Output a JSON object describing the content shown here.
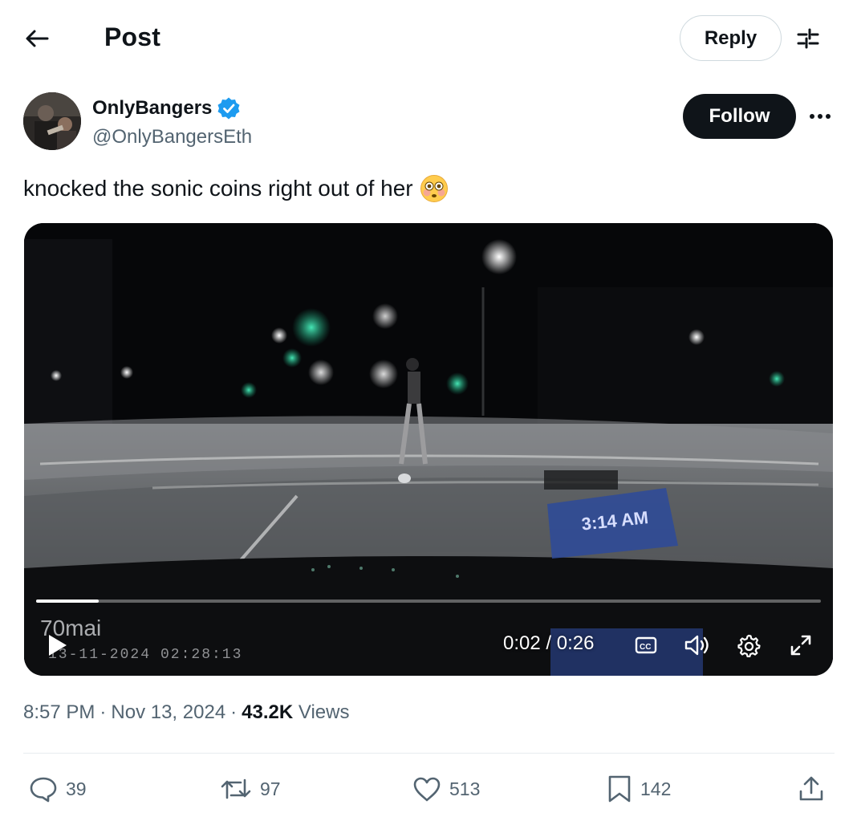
{
  "header": {
    "title": "Post",
    "reply_label": "Reply",
    "back_icon": "arrow-left-icon",
    "filter_icon": "sliders-icon"
  },
  "author": {
    "name": "OnlyBangers",
    "handle": "@OnlyBangersEth",
    "verified": true,
    "follow_label": "Follow"
  },
  "tweet": {
    "text": "knocked the sonic coins right out of her",
    "emoji": "flushed-face"
  },
  "video": {
    "time_current": "0:02",
    "time_separator": "/",
    "time_total": "0:26",
    "progress_fraction": 0.08,
    "controls": [
      "play-icon",
      "captions-icon",
      "volume-icon",
      "settings-icon",
      "fullscreen-icon"
    ],
    "overlay": {
      "brand": "70mai",
      "date_stamp": "13-11-2024",
      "time_stamp": "02:28:13",
      "sign_text": "3:14 AM"
    }
  },
  "meta": {
    "time": "8:57 PM",
    "separator": "·",
    "date": "Nov 13, 2024",
    "views_count": "43.2K",
    "views_label": "Views"
  },
  "stats": {
    "replies": "39",
    "reposts": "97",
    "likes": "513",
    "bookmarks": "142"
  },
  "colors": {
    "text_primary": "#0f1419",
    "text_secondary": "#536471",
    "verified_blue": "#1d9bf0",
    "border": "#cfd9de"
  }
}
